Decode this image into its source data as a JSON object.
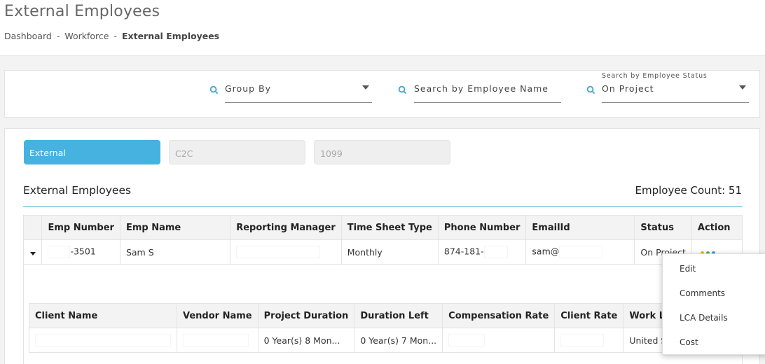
{
  "page": {
    "title": "External Employees",
    "breadcrumb": [
      "Dashboard",
      "Workforce",
      "External Employees"
    ]
  },
  "filters": {
    "group_by": {
      "value": "Group By"
    },
    "employee_name": {
      "placeholder": "Search by Employee Name"
    },
    "employee_status": {
      "label": "Search by Employee Status",
      "value": "On Project"
    }
  },
  "tabs": [
    {
      "label": "External",
      "active": true
    },
    {
      "label": "C2C",
      "active": false
    },
    {
      "label": "1099",
      "active": false
    }
  ],
  "section": {
    "title": "External Employees",
    "count_label": "Employee Count: 51"
  },
  "employees_table": {
    "columns": [
      "Emp Number",
      "Emp Name",
      "Reporting Manager",
      "Time Sheet Type",
      "Phone Number",
      "EmailId",
      "Status",
      "Action"
    ],
    "rows": [
      {
        "emp_number": "-3501",
        "emp_name": "Sam S",
        "reporting_manager": "",
        "time_sheet_type": "Monthly",
        "phone_number": "874-181-",
        "email": "sam@",
        "status": "On Project"
      }
    ]
  },
  "project_table": {
    "columns": [
      "Client Name",
      "Vendor Name",
      "Project Duration",
      "Duration Left",
      "Compensation Rate",
      "Client Rate",
      "Work Location"
    ],
    "rows": [
      {
        "client_name": "",
        "vendor_name": "",
        "project_duration": "0 Year(s) 8 Mon...",
        "duration_left": "0 Year(s) 7 Mon...",
        "compensation_rate": "",
        "client_rate": "",
        "work_location": "United States of Am"
      }
    ]
  },
  "action_menu": {
    "items": [
      "Edit",
      "Comments",
      "LCA Details",
      "Cost"
    ]
  },
  "colors": {
    "accent": "#45b2df",
    "action_dots": [
      "#f0b400",
      "#4caf50",
      "#2196f3"
    ]
  }
}
